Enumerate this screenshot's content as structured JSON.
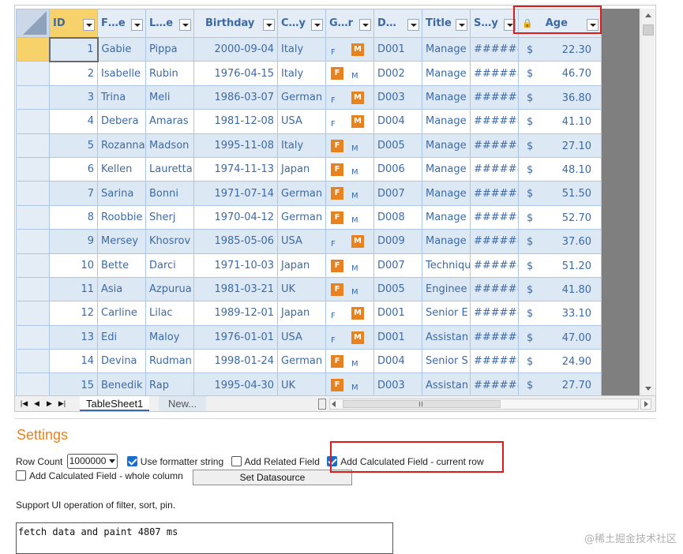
{
  "grid": {
    "headers": {
      "id": "ID",
      "first": "F…e",
      "last": "L…e",
      "birthday": "Birthday",
      "country": "C…y",
      "gender": "G…r",
      "dept": "D…",
      "title": "Title",
      "salary": "S…y",
      "age": "Age"
    },
    "rows": [
      {
        "id": "1",
        "first": "Gabie",
        "last": "Pippa",
        "birthday": "2000-09-04",
        "country": "Italy",
        "gender": "M",
        "dept": "D001",
        "title": "Manage",
        "salary": "######",
        "cur": "$",
        "age": "22.30"
      },
      {
        "id": "2",
        "first": "Isabelle",
        "last": "Rubin",
        "birthday": "1976-04-15",
        "country": "Italy",
        "gender": "F",
        "dept": "D002",
        "title": "Manage",
        "salary": "######",
        "cur": "$",
        "age": "46.70"
      },
      {
        "id": "3",
        "first": "Trina",
        "last": "Meli",
        "birthday": "1986-03-07",
        "country": "German",
        "gender": "M",
        "dept": "D003",
        "title": "Manage",
        "salary": "######",
        "cur": "$",
        "age": "36.80"
      },
      {
        "id": "4",
        "first": "Debera",
        "last": "Amaras",
        "birthday": "1981-12-08",
        "country": "USA",
        "gender": "M",
        "dept": "D004",
        "title": "Manage",
        "salary": "######",
        "cur": "$",
        "age": "41.10"
      },
      {
        "id": "5",
        "first": "Rozanna",
        "last": "Madson",
        "birthday": "1995-11-08",
        "country": "Italy",
        "gender": "F",
        "dept": "D005",
        "title": "Manage",
        "salary": "######",
        "cur": "$",
        "age": "27.10"
      },
      {
        "id": "6",
        "first": "Kellen",
        "last": "Lauretta",
        "birthday": "1974-11-13",
        "country": "Japan",
        "gender": "F",
        "dept": "D006",
        "title": "Manage",
        "salary": "######",
        "cur": "$",
        "age": "48.10"
      },
      {
        "id": "7",
        "first": "Sarina",
        "last": "Bonni",
        "birthday": "1971-07-14",
        "country": "German",
        "gender": "F",
        "dept": "D007",
        "title": "Manage",
        "salary": "######",
        "cur": "$",
        "age": "51.50"
      },
      {
        "id": "8",
        "first": "Roobbie",
        "last": "Sherj",
        "birthday": "1970-04-12",
        "country": "German",
        "gender": "F",
        "dept": "D008",
        "title": "Manage",
        "salary": "######",
        "cur": "$",
        "age": "52.70"
      },
      {
        "id": "9",
        "first": "Mersey",
        "last": "Khosrov",
        "birthday": "1985-05-06",
        "country": "USA",
        "gender": "M",
        "dept": "D009",
        "title": "Manage",
        "salary": "######",
        "cur": "$",
        "age": "37.60"
      },
      {
        "id": "10",
        "first": "Bette",
        "last": "Darci",
        "birthday": "1971-10-03",
        "country": "Japan",
        "gender": "F",
        "dept": "D007",
        "title": "Techniqu",
        "salary": "######",
        "cur": "$",
        "age": "51.20"
      },
      {
        "id": "11",
        "first": "Asia",
        "last": "Azpurua",
        "birthday": "1981-03-21",
        "country": "UK",
        "gender": "F",
        "dept": "D005",
        "title": "Enginee",
        "salary": "######",
        "cur": "$",
        "age": "41.80"
      },
      {
        "id": "12",
        "first": "Carline",
        "last": "Lilac",
        "birthday": "1989-12-01",
        "country": "Japan",
        "gender": "M",
        "dept": "D001",
        "title": "Senior E",
        "salary": "######",
        "cur": "$",
        "age": "33.10"
      },
      {
        "id": "13",
        "first": "Edi",
        "last": "Maloy",
        "birthday": "1976-01-01",
        "country": "USA",
        "gender": "M",
        "dept": "D001",
        "title": "Assistan",
        "salary": "######",
        "cur": "$",
        "age": "47.00"
      },
      {
        "id": "14",
        "first": "Devina",
        "last": "Rudman",
        "birthday": "1998-01-24",
        "country": "German",
        "gender": "F",
        "dept": "D004",
        "title": "Senior S",
        "salary": "######",
        "cur": "$",
        "age": "24.90"
      },
      {
        "id": "15",
        "first": "Benedik",
        "last": "Rap",
        "birthday": "1995-04-30",
        "country": "UK",
        "gender": "F",
        "dept": "D003",
        "title": "Assistan",
        "salary": "######",
        "cur": "$",
        "age": "27.70"
      }
    ]
  },
  "tabbar": {
    "nav_first": "|◀",
    "nav_prev": "◀",
    "nav_next": "▶",
    "nav_last": "▶|",
    "sheet_tab": "TableSheet1",
    "new_tab": "New..."
  },
  "settings": {
    "title": "Settings",
    "row_count_label": "Row Count",
    "row_count_value": "1000000",
    "use_formatter": "Use formatter string",
    "add_related": "Add Related Field",
    "add_calc_row": "Add Calculated Field - current row",
    "add_calc_col": "Add Calculated Field - whole column",
    "set_datasource": "Set Datasource",
    "support_text": "Support UI operation of filter, sort, pin.",
    "output_text": "fetch data and paint 4807 ms"
  },
  "watermark": "@稀土掘金技术社区",
  "colors": {
    "accent": "#e8821e",
    "header_text": "#3d6aa6",
    "highlight_border": "#e0191b",
    "selected_header": "#f7d169"
  }
}
